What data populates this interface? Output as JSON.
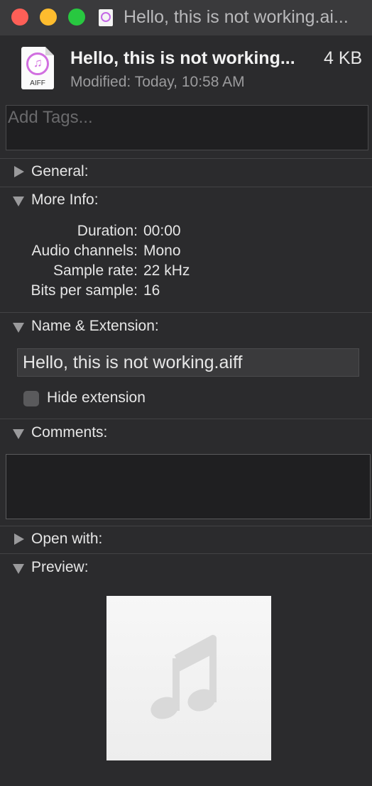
{
  "window": {
    "title": "Hello, this is not working.ai..."
  },
  "header": {
    "file_name": "Hello, this is not working...",
    "file_size": "4 KB",
    "modified_label": "Modified:",
    "modified_value": "Today, 10:58 AM",
    "icon_badge": "AIFF"
  },
  "tags": {
    "placeholder": "Add Tags..."
  },
  "sections": {
    "general": "General:",
    "more_info": "More Info:",
    "name_extension": "Name & Extension:",
    "comments": "Comments:",
    "open_with": "Open with:",
    "preview": "Preview:"
  },
  "more_info": {
    "rows": [
      {
        "label": "Duration:",
        "value": "00:00"
      },
      {
        "label": "Audio channels:",
        "value": "Mono"
      },
      {
        "label": "Sample rate:",
        "value": "22 kHz"
      },
      {
        "label": "Bits per sample:",
        "value": "16"
      }
    ]
  },
  "name_extension": {
    "value": "Hello, this is not working.aiff",
    "hide_extension_label": "Hide extension",
    "hide_extension_checked": false
  },
  "comments": {
    "value": ""
  },
  "colors": {
    "close": "#fe5f57",
    "minimize": "#febc2e",
    "zoom": "#28c840",
    "music_accent": "#d16fe0"
  },
  "icons": {
    "file": "aiff-music-file-icon",
    "preview": "music-note-icon"
  }
}
